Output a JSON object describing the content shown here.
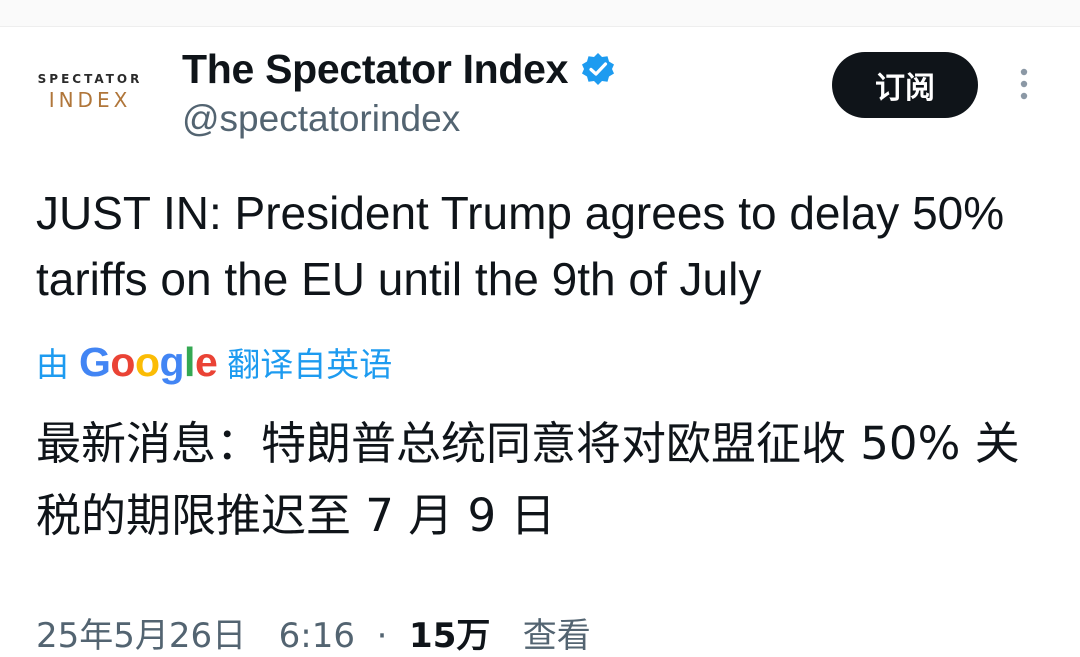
{
  "author": {
    "logo_top": "SPECTATOR",
    "logo_bottom": "INDEX",
    "display_name": "The Spectator Index",
    "handle": "@spectatorindex",
    "verified_icon": "verified-badge-icon"
  },
  "actions": {
    "subscribe_label": "订阅",
    "more_icon": "more-vertical-icon"
  },
  "tweet": {
    "text": "JUST IN: President Trump agrees to delay 50% tariffs on the EU until the 9th of July"
  },
  "translation": {
    "prefix": "由",
    "provider": "Google",
    "suffix": "翻译自英语",
    "text": "最新消息：特朗普总统同意将对欧盟征收 50% 关税的期限推迟至 7 月 9 日"
  },
  "meta": {
    "date": "25年5月26日",
    "time": "6:16",
    "views_count": "15万",
    "views_label": "查看"
  },
  "colors": {
    "accent": "#1d9bf0",
    "text": "#0f1419",
    "muted": "#536471",
    "logo_gold": "#b0763a"
  }
}
